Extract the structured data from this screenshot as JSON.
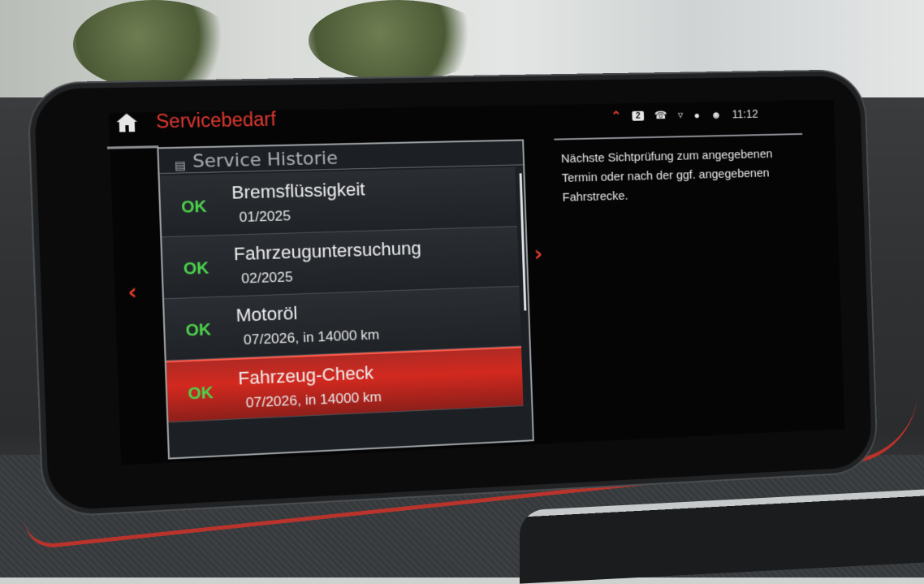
{
  "header": {
    "title": "Servicebedarf",
    "clock": "11:12",
    "badge_number": "2",
    "status_icons": [
      "chevron-up-icon",
      "phone-icon",
      "speaker-icon",
      "microphone-icon",
      "profile-icon"
    ]
  },
  "list": {
    "history_label": "Service Historie",
    "items": [
      {
        "status": "OK",
        "name": "Bremsflüssigkeit",
        "date": "01/2025"
      },
      {
        "status": "OK",
        "name": "Fahrzeuguntersuchung",
        "date": "02/2025"
      },
      {
        "status": "OK",
        "name": "Motoröl",
        "date": "07/2026, in 14000 km"
      },
      {
        "status": "OK",
        "name": "Fahrzeug-Check",
        "date": "07/2026, in 14000 km"
      }
    ],
    "selected_index": 3
  },
  "info": {
    "text": "Nächste Sichtprüfung zum angegebenen Termin oder nach der ggf. angegebenen Fahrstrecke."
  },
  "colors": {
    "accent": "#e2392f",
    "ok": "#4cd34c",
    "selected_row": "#d2291f"
  }
}
